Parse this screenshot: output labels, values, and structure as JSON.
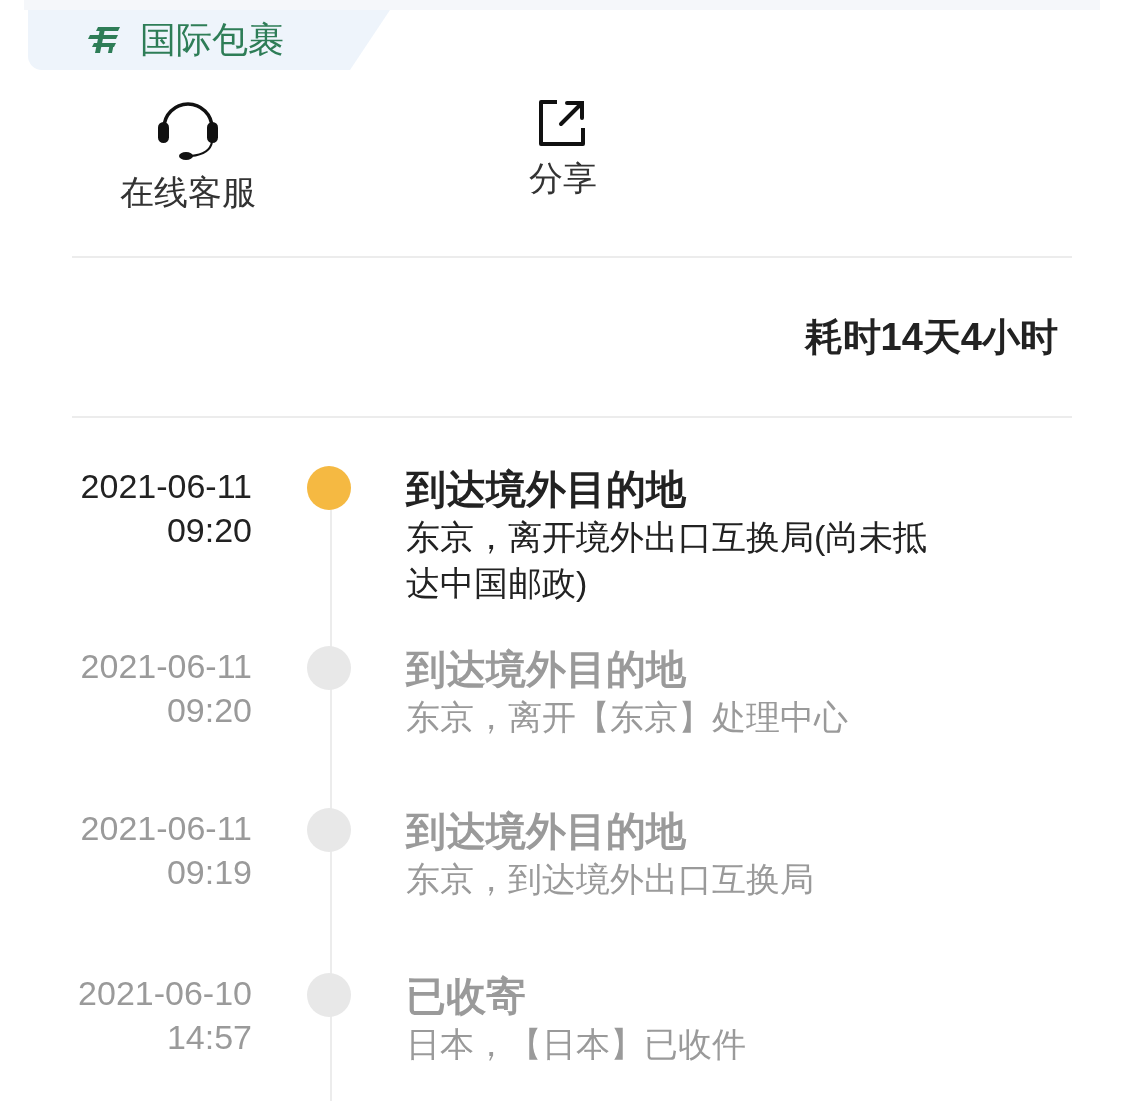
{
  "header_tab": {
    "label": "国际包裹"
  },
  "actions": [
    {
      "kind": "support",
      "label": "在线客服"
    },
    {
      "kind": "share",
      "label": "分享"
    }
  ],
  "duration": "耗时14天4小时",
  "events": [
    {
      "date": "2021-06-11",
      "time": "09:20",
      "title": "到达境外目的地",
      "detail": "东京，离开境外出口互换局(尚未抵达中国邮政)",
      "current": true
    },
    {
      "date": "2021-06-11",
      "time": "09:20",
      "title": "到达境外目的地",
      "detail": "东京，离开【东京】处理中心",
      "current": false
    },
    {
      "date": "2021-06-11",
      "time": "09:19",
      "title": "到达境外目的地",
      "detail": "东京，到达境外出口互换局",
      "current": false
    },
    {
      "date": "2021-06-10",
      "time": "14:57",
      "title": "已收寄",
      "detail": "日本，【日本】已收件",
      "current": false
    }
  ]
}
